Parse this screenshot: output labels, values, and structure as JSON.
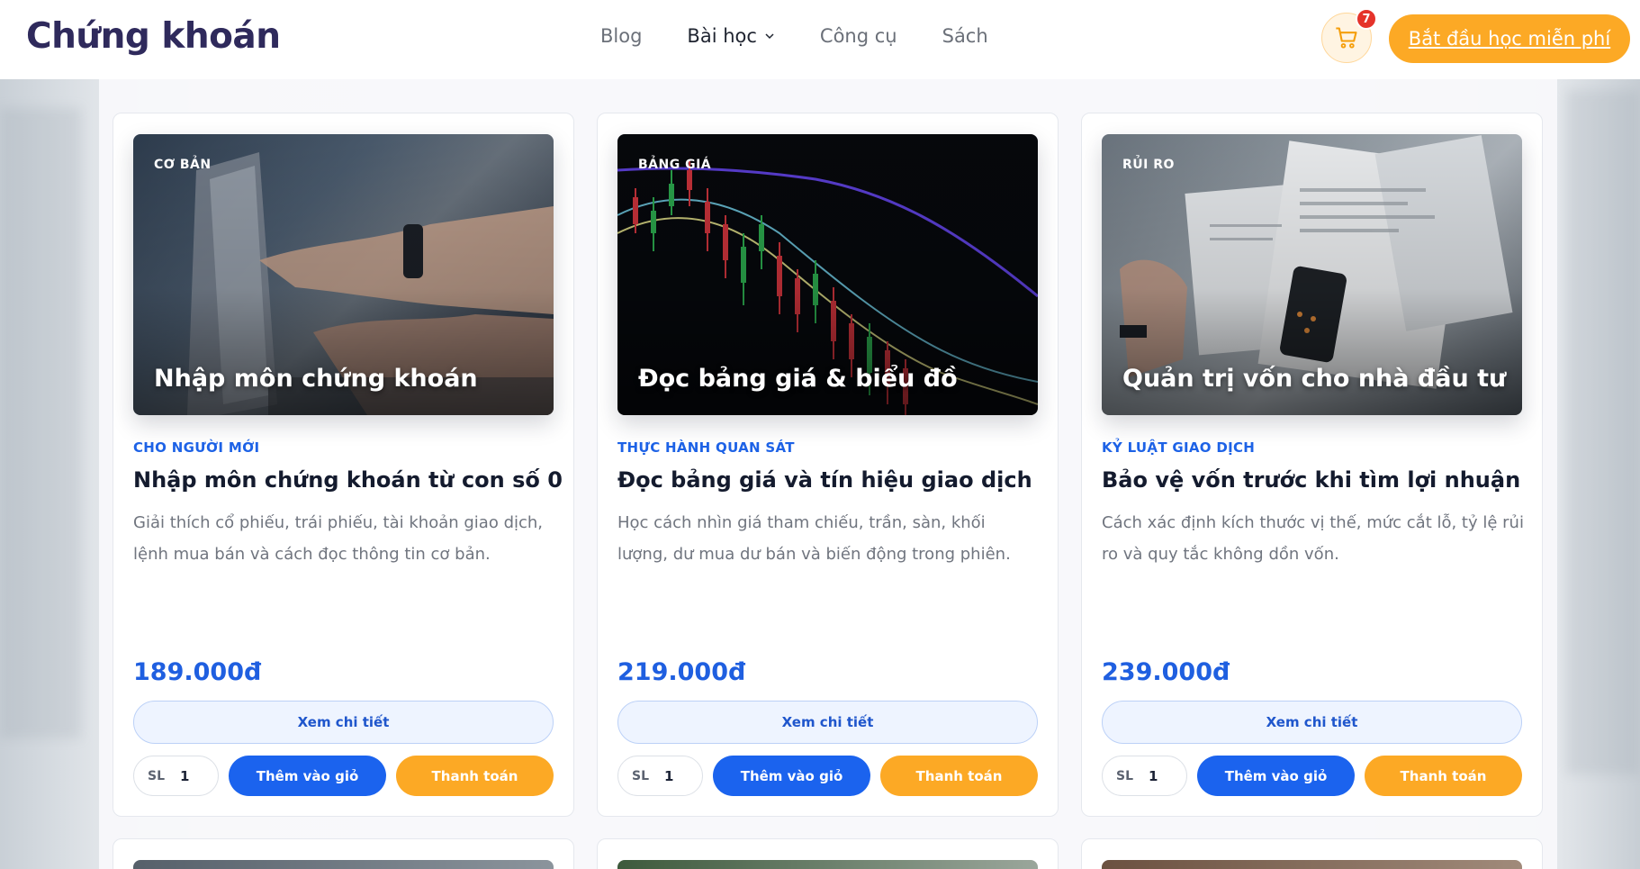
{
  "header": {
    "logo": "Chứng khoán",
    "nav": [
      "Blog",
      "Bài học",
      "Công cụ",
      "Sách"
    ],
    "cart_count": "7",
    "cta_label": "Bắt đầu học miễn phí"
  },
  "courses": [
    {
      "tag": "CƠ BẢN",
      "thumb_title": "Nhập môn chứng khoán",
      "subtitle": "CHO NGƯỜI MỚI",
      "title": "Nhập môn chứng khoán từ con số 0",
      "desc": "Giải thích cổ phiếu, trái phiếu, tài khoản giao dịch, lệnh mua bán và cách đọc thông tin cơ bản.",
      "price": "189.000đ",
      "detail_label": "Xem chi tiết",
      "qty_label": "SL",
      "qty_value": "1",
      "add_cart_label": "Thêm vào giỏ",
      "pay_label": "Thanh toán"
    },
    {
      "tag": "BẢNG GIÁ",
      "thumb_title": "Đọc bảng giá & biểu đồ",
      "subtitle": "THỰC HÀNH QUAN SÁT",
      "title": "Đọc bảng giá và tín hiệu giao dịch",
      "desc": "Học cách nhìn giá tham chiếu, trần, sàn, khối lượng, dư mua dư bán và biến động trong phiên.",
      "price": "219.000đ",
      "detail_label": "Xem chi tiết",
      "qty_label": "SL",
      "qty_value": "1",
      "add_cart_label": "Thêm vào giỏ",
      "pay_label": "Thanh toán"
    },
    {
      "tag": "RỦI RO",
      "thumb_title": "Quản trị vốn cho nhà đầu tư",
      "subtitle": "KỶ LUẬT GIAO DỊCH",
      "title": "Bảo vệ vốn trước khi tìm lợi nhuận",
      "desc": "Cách xác định kích thước vị thế, mức cắt lỗ, tỷ lệ rủi ro và quy tắc không dồn vốn.",
      "price": "239.000đ",
      "detail_label": "Xem chi tiết",
      "qty_label": "SL",
      "qty_value": "1",
      "add_cart_label": "Thêm vào giỏ",
      "pay_label": "Thanh toán"
    }
  ],
  "colors": {
    "brand_blue": "#1b63ee",
    "accent_orange": "#fca925",
    "logo": "#2f2a5c"
  }
}
